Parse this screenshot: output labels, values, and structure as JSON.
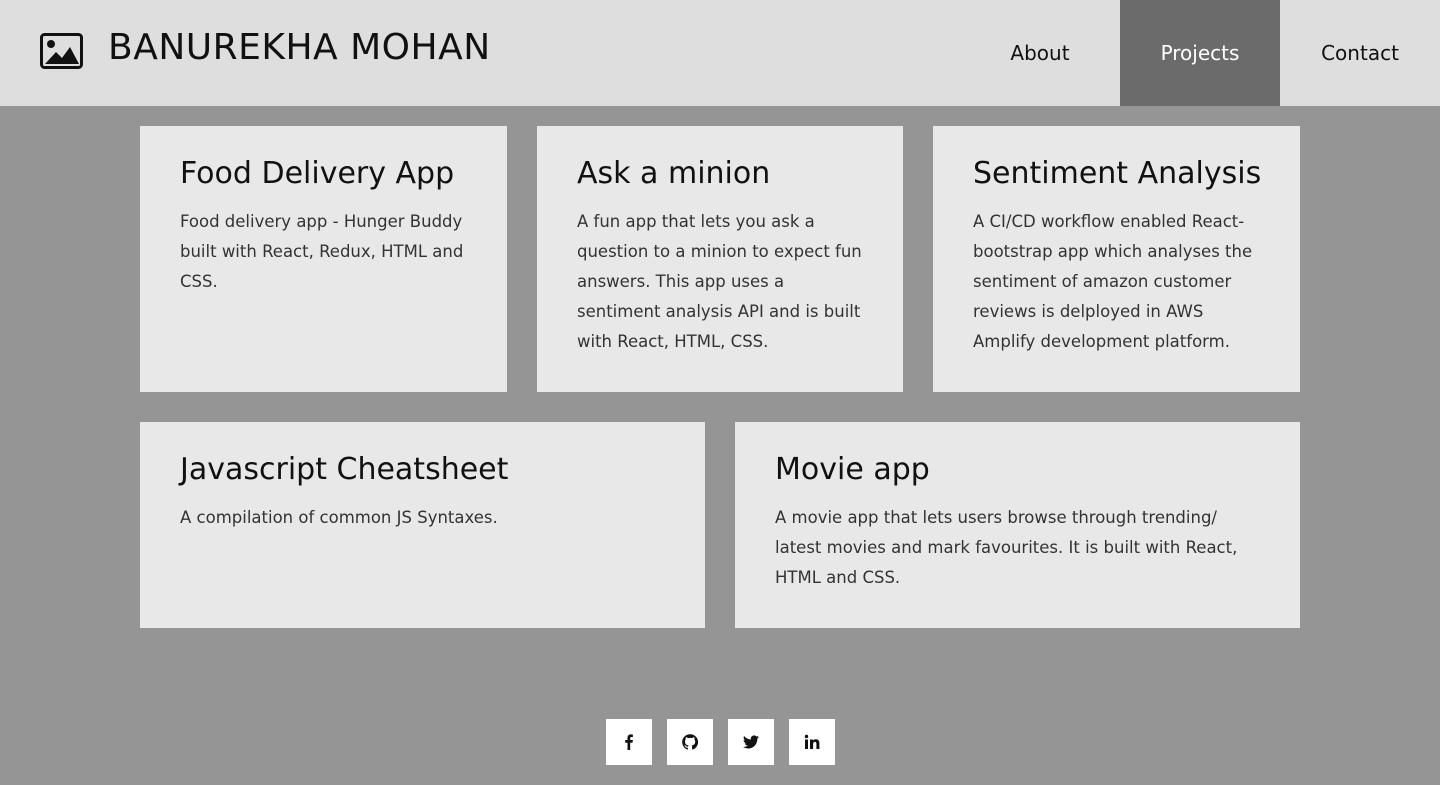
{
  "header": {
    "title": "BANUREKHA MOHAN",
    "logo_icon": "image-icon"
  },
  "nav": {
    "items": [
      {
        "label": "About",
        "active": false
      },
      {
        "label": "Projects",
        "active": true
      },
      {
        "label": "Contact",
        "active": false
      }
    ]
  },
  "projects": [
    {
      "title": "Food Delivery App",
      "description": "Food delivery app - Hunger Buddy built with React, Redux, HTML and CSS."
    },
    {
      "title": "Ask a minion",
      "description": "A fun app that lets you ask a question to a minion to expect fun answers. This app uses a sentiment analysis API and is built with React, HTML, CSS."
    },
    {
      "title": "Sentiment Analysis",
      "description": "A CI/CD workflow enabled React-bootstrap app which analyses the sentiment of amazon customer reviews is delployed in AWS Amplify development platform."
    },
    {
      "title": "Javascript Cheatsheet",
      "description": "A compilation of common JS Syntaxes."
    },
    {
      "title": "Movie app",
      "description": "A movie app that lets users browse through trending/ latest movies and mark favourites. It is built with React, HTML and CSS."
    }
  ],
  "social": {
    "icons": [
      "facebook-icon",
      "github-icon",
      "twitter-icon",
      "linkedin-icon"
    ]
  },
  "colors": {
    "background": "#959595",
    "header": "#dedede",
    "nav_active": "#6b6b6b",
    "card": "#e8e8e8"
  }
}
